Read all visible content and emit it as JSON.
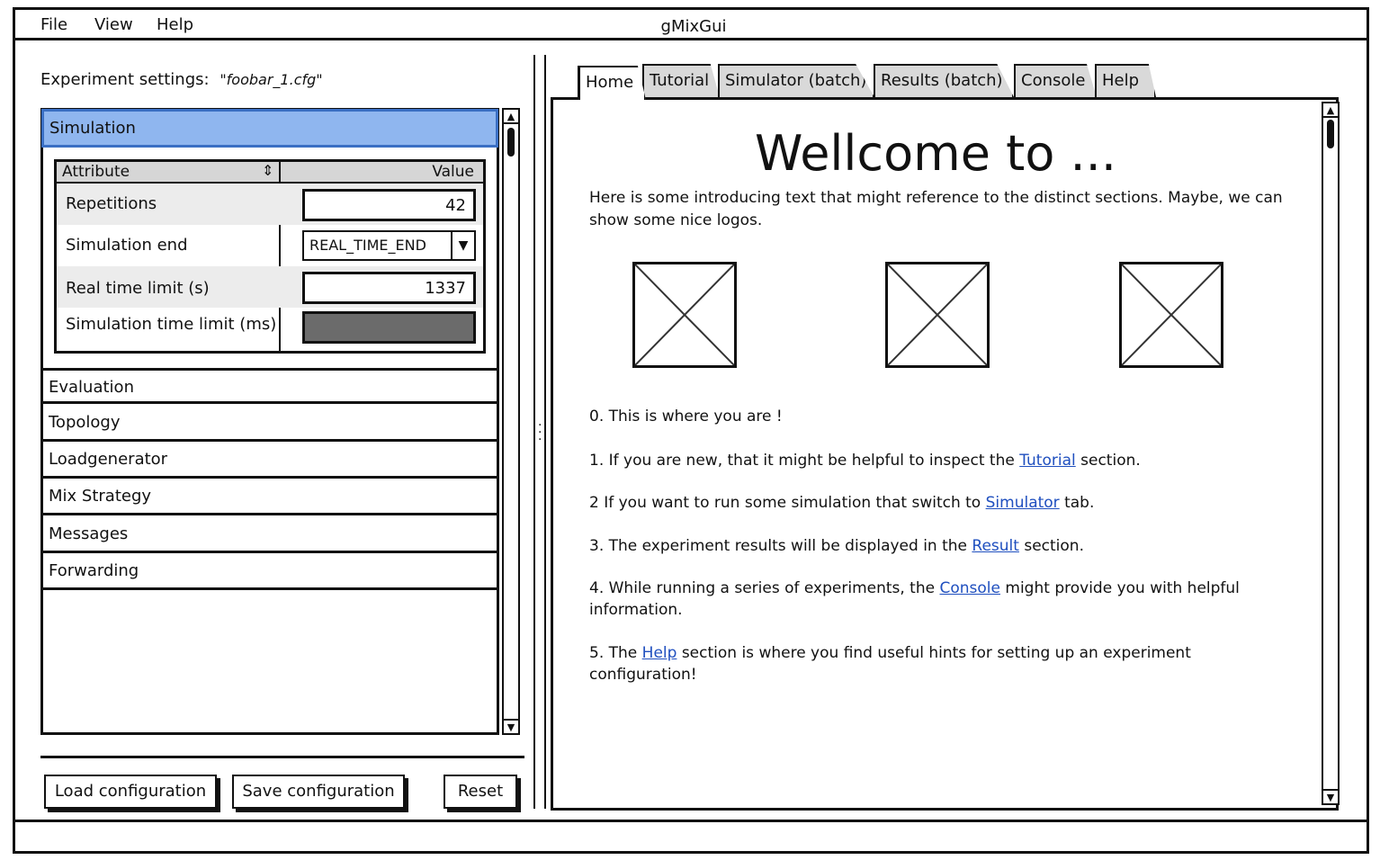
{
  "menubar": {
    "file": "File",
    "view": "View",
    "help": "Help",
    "title": "gMixGui"
  },
  "settings": {
    "label": "Experiment settings:",
    "filename": "\"foobar_1.cfg\""
  },
  "accordion": {
    "sections": [
      "Simulation",
      "Evaluation",
      "Topology",
      "Loadgenerator",
      "Mix Strategy",
      "Messages",
      "Forwarding"
    ],
    "active": "Simulation"
  },
  "properties": {
    "header_attribute": "Attribute",
    "header_value": "Value",
    "rows": [
      {
        "label": "Repetitions",
        "value": "42"
      },
      {
        "label": "Simulation end",
        "value": "REAL_TIME_END"
      },
      {
        "label": "Real time limit (s)",
        "value": "1337"
      },
      {
        "label": "Simulation time limit (ms)",
        "value": ""
      }
    ]
  },
  "buttons": {
    "load": "Load configuration",
    "save": "Save configuration",
    "reset": "Reset"
  },
  "tabs": [
    "Home",
    "Tutorial",
    "Simulator (batch)",
    "Results (batch)",
    "Console",
    "Help"
  ],
  "active_tab": "Home",
  "home": {
    "title": "Wellcome to ...",
    "intro": "Here is some introducing text that might reference to the distinct sections. Maybe, we can show some nice logos.",
    "step0": "0. This is where you are !",
    "step1_pre": "1. If you are new, that it might be helpful to inspect the ",
    "step1_link": "Tutorial",
    "step1_post": " section.",
    "step2_pre": "2 If you want to run some simulation that switch to ",
    "step2_link": "Simulator",
    "step2_post": " tab.",
    "step3_pre": "3. The experiment results will be displayed in the ",
    "step3_link": "Result",
    "step3_post": " section.",
    "step4_pre": "4. While running a series of experiments, the ",
    "step4_link": "Console",
    "step4_post": " might provide you with helpful information.",
    "step5_pre": "5. The ",
    "step5_link": "Help",
    "step5_post": " section is where you find useful hints for setting up an experiment configuration!"
  },
  "icons": {
    "sort": "sort-icon",
    "dropdown": "chevron-down-icon",
    "scroll_up": "arrow-up-icon",
    "scroll_down": "arrow-down-icon",
    "logo_placeholder": "image-placeholder-icon",
    "splitter_grip": "grip-icon"
  }
}
